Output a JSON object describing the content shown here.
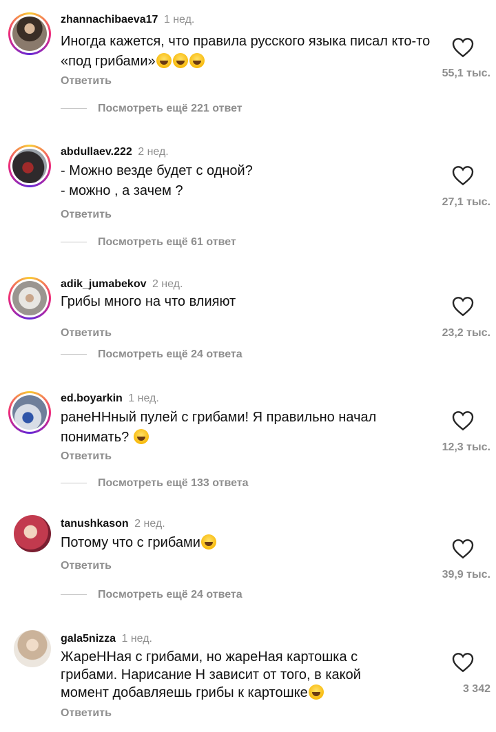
{
  "comments": [
    {
      "username": "zhannachibaeva17",
      "time": "1 нед.",
      "text": "Иногда кажется, что правила русского языка писал кто-то «под грибами»",
      "emojis": "😂😂😂",
      "reply_label": "Ответить",
      "likes": "55,1 тыс.",
      "more_replies": "Посмотреть ещё 221 ответ",
      "avatar_color": "#5a4a3c"
    },
    {
      "username": "abdullaev.222",
      "time": "2 нед.",
      "text_lines": [
        "- Можно везде будет с одной?",
        "- можно , а зачем ?"
      ],
      "reply_label": "Ответить",
      "likes": "27,1 тыс.",
      "more_replies": "Посмотреть ещё 61 ответ",
      "avatar_color": "#2e2a2c"
    },
    {
      "username": "adik_jumabekov",
      "time": "2 нед.",
      "text": "Грибы много на что влияют",
      "reply_label": "Ответить",
      "likes": "23,2 тыс.",
      "more_replies": "Посмотреть ещё 24 ответа",
      "avatar_color": "#bfb7ac"
    },
    {
      "username": "ed.boyarkin",
      "time": "1 нед.",
      "text": "ранеННный пулей с грибами!  Я правильно начал понимать?",
      "emojis": "😆",
      "reply_label": "Ответить",
      "likes": "12,3 тыс.",
      "more_replies": "Посмотреть ещё 133 ответа",
      "avatar_color": "#7d94b8"
    },
    {
      "username": "tanushkason",
      "time": "2 нед.",
      "text": "Потому что с грибами",
      "emojis": "😂",
      "reply_label": "Ответить",
      "likes": "39,9 тыс.",
      "more_replies": "Посмотреть ещё 24 ответа",
      "avatar_color": "#b0304a"
    },
    {
      "username": "gala5nizza",
      "time": "1 нед.",
      "text": "ЖареННая с грибами, но жареНая картошка с грибами. Нарисание Н зависит от того, в какой момент добавляешь грибы к картошке",
      "emojis": "😁",
      "reply_label": "Ответить",
      "likes": "3 342",
      "avatar_color": "#d8c4b0"
    }
  ],
  "colors": {
    "muted": "#8e8e8e",
    "text": "#111111",
    "story_ring": "#ee2a7b"
  },
  "icons": {
    "like": "heart-outline-icon"
  }
}
